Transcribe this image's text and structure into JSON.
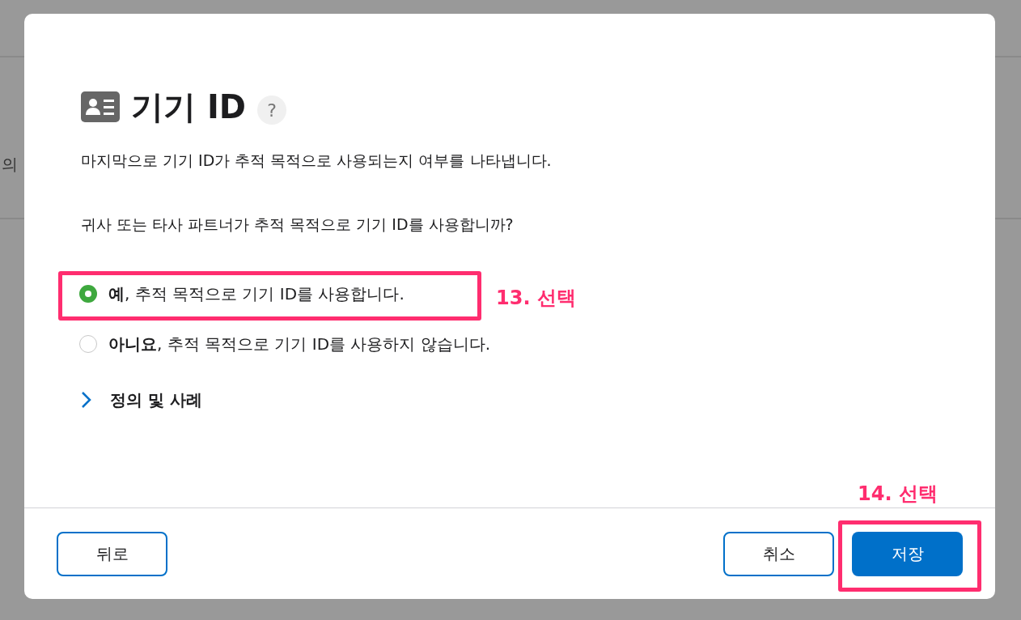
{
  "background": {
    "text": "의"
  },
  "dialog": {
    "title": "기기 ID",
    "help": "?",
    "description": "마지막으로 기기 ID가 추적 목적으로 사용되는지 여부를 나타냅니다.",
    "question": "귀사 또는 타사 파트너가 추적 목적으로 기기 ID를 사용합니까?",
    "options": [
      {
        "label": "**예**, 추적 목적으로 기기 ID를 사용합니다.",
        "selected": true
      },
      {
        "label": "**아니요**, 추적 목적으로 기기 ID를 사용하지 않습니다.",
        "selected": false
      }
    ],
    "disclosure": {
      "label": "정의 및 사례",
      "expanded": false
    },
    "buttons": {
      "back": "뒤로",
      "cancel": "취소",
      "save": "저장"
    }
  },
  "annotations": [
    {
      "label": "13. 선택"
    },
    {
      "label": "14. 선택"
    }
  ]
}
